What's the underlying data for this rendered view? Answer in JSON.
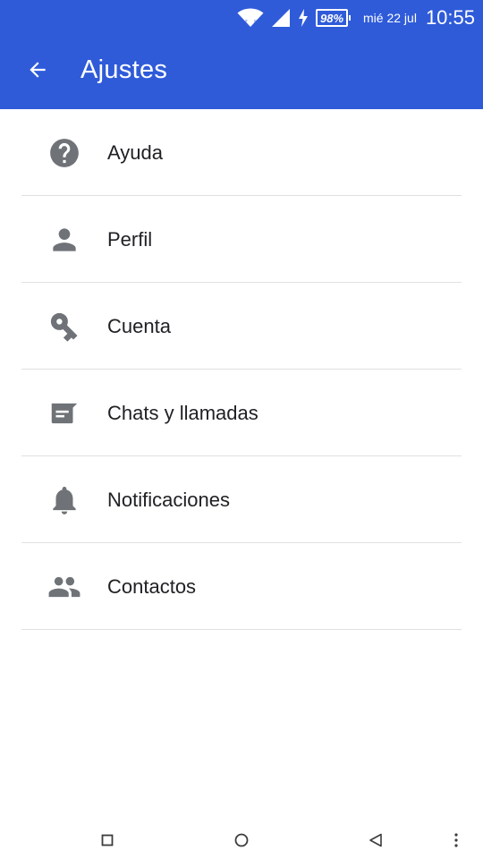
{
  "status_bar": {
    "battery_percent": "98%",
    "date": "mié 22 jul",
    "time": "10:55",
    "icons": [
      "wifi-icon",
      "signal-icon",
      "charging-icon",
      "battery-icon"
    ]
  },
  "toolbar": {
    "back_icon": "arrow-back-icon",
    "title": "Ajustes",
    "background_color": "#2f5bd9"
  },
  "settings": {
    "items": [
      {
        "label": "Ayuda",
        "icon": "help-icon"
      },
      {
        "label": "Perfil",
        "icon": "person-icon"
      },
      {
        "label": "Cuenta",
        "icon": "key-icon"
      },
      {
        "label": "Chats y llamadas",
        "icon": "chat-icon"
      },
      {
        "label": "Notificaciones",
        "icon": "bell-icon"
      },
      {
        "label": "Contactos",
        "icon": "people-icon"
      }
    ],
    "icon_color": "#6f7377"
  },
  "nav_bar": {
    "buttons": [
      "recents-square-icon",
      "home-circle-icon",
      "back-triangle-icon",
      "more-vert-icon"
    ]
  }
}
